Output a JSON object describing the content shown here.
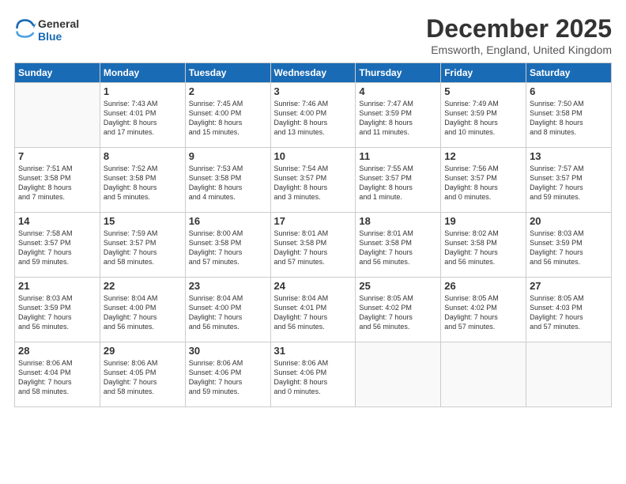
{
  "logo": {
    "line1": "General",
    "line2": "Blue"
  },
  "title": "December 2025",
  "location": "Emsworth, England, United Kingdom",
  "days_header": [
    "Sunday",
    "Monday",
    "Tuesday",
    "Wednesday",
    "Thursday",
    "Friday",
    "Saturday"
  ],
  "weeks": [
    [
      {
        "day": "",
        "info": ""
      },
      {
        "day": "1",
        "info": "Sunrise: 7:43 AM\nSunset: 4:01 PM\nDaylight: 8 hours\nand 17 minutes."
      },
      {
        "day": "2",
        "info": "Sunrise: 7:45 AM\nSunset: 4:00 PM\nDaylight: 8 hours\nand 15 minutes."
      },
      {
        "day": "3",
        "info": "Sunrise: 7:46 AM\nSunset: 4:00 PM\nDaylight: 8 hours\nand 13 minutes."
      },
      {
        "day": "4",
        "info": "Sunrise: 7:47 AM\nSunset: 3:59 PM\nDaylight: 8 hours\nand 11 minutes."
      },
      {
        "day": "5",
        "info": "Sunrise: 7:49 AM\nSunset: 3:59 PM\nDaylight: 8 hours\nand 10 minutes."
      },
      {
        "day": "6",
        "info": "Sunrise: 7:50 AM\nSunset: 3:58 PM\nDaylight: 8 hours\nand 8 minutes."
      }
    ],
    [
      {
        "day": "7",
        "info": "Sunrise: 7:51 AM\nSunset: 3:58 PM\nDaylight: 8 hours\nand 7 minutes."
      },
      {
        "day": "8",
        "info": "Sunrise: 7:52 AM\nSunset: 3:58 PM\nDaylight: 8 hours\nand 5 minutes."
      },
      {
        "day": "9",
        "info": "Sunrise: 7:53 AM\nSunset: 3:58 PM\nDaylight: 8 hours\nand 4 minutes."
      },
      {
        "day": "10",
        "info": "Sunrise: 7:54 AM\nSunset: 3:57 PM\nDaylight: 8 hours\nand 3 minutes."
      },
      {
        "day": "11",
        "info": "Sunrise: 7:55 AM\nSunset: 3:57 PM\nDaylight: 8 hours\nand 1 minute."
      },
      {
        "day": "12",
        "info": "Sunrise: 7:56 AM\nSunset: 3:57 PM\nDaylight: 8 hours\nand 0 minutes."
      },
      {
        "day": "13",
        "info": "Sunrise: 7:57 AM\nSunset: 3:57 PM\nDaylight: 7 hours\nand 59 minutes."
      }
    ],
    [
      {
        "day": "14",
        "info": "Sunrise: 7:58 AM\nSunset: 3:57 PM\nDaylight: 7 hours\nand 59 minutes."
      },
      {
        "day": "15",
        "info": "Sunrise: 7:59 AM\nSunset: 3:57 PM\nDaylight: 7 hours\nand 58 minutes."
      },
      {
        "day": "16",
        "info": "Sunrise: 8:00 AM\nSunset: 3:58 PM\nDaylight: 7 hours\nand 57 minutes."
      },
      {
        "day": "17",
        "info": "Sunrise: 8:01 AM\nSunset: 3:58 PM\nDaylight: 7 hours\nand 57 minutes."
      },
      {
        "day": "18",
        "info": "Sunrise: 8:01 AM\nSunset: 3:58 PM\nDaylight: 7 hours\nand 56 minutes."
      },
      {
        "day": "19",
        "info": "Sunrise: 8:02 AM\nSunset: 3:58 PM\nDaylight: 7 hours\nand 56 minutes."
      },
      {
        "day": "20",
        "info": "Sunrise: 8:03 AM\nSunset: 3:59 PM\nDaylight: 7 hours\nand 56 minutes."
      }
    ],
    [
      {
        "day": "21",
        "info": "Sunrise: 8:03 AM\nSunset: 3:59 PM\nDaylight: 7 hours\nand 56 minutes."
      },
      {
        "day": "22",
        "info": "Sunrise: 8:04 AM\nSunset: 4:00 PM\nDaylight: 7 hours\nand 56 minutes."
      },
      {
        "day": "23",
        "info": "Sunrise: 8:04 AM\nSunset: 4:00 PM\nDaylight: 7 hours\nand 56 minutes."
      },
      {
        "day": "24",
        "info": "Sunrise: 8:04 AM\nSunset: 4:01 PM\nDaylight: 7 hours\nand 56 minutes."
      },
      {
        "day": "25",
        "info": "Sunrise: 8:05 AM\nSunset: 4:02 PM\nDaylight: 7 hours\nand 56 minutes."
      },
      {
        "day": "26",
        "info": "Sunrise: 8:05 AM\nSunset: 4:02 PM\nDaylight: 7 hours\nand 57 minutes."
      },
      {
        "day": "27",
        "info": "Sunrise: 8:05 AM\nSunset: 4:03 PM\nDaylight: 7 hours\nand 57 minutes."
      }
    ],
    [
      {
        "day": "28",
        "info": "Sunrise: 8:06 AM\nSunset: 4:04 PM\nDaylight: 7 hours\nand 58 minutes."
      },
      {
        "day": "29",
        "info": "Sunrise: 8:06 AM\nSunset: 4:05 PM\nDaylight: 7 hours\nand 58 minutes."
      },
      {
        "day": "30",
        "info": "Sunrise: 8:06 AM\nSunset: 4:06 PM\nDaylight: 7 hours\nand 59 minutes."
      },
      {
        "day": "31",
        "info": "Sunrise: 8:06 AM\nSunset: 4:06 PM\nDaylight: 8 hours\nand 0 minutes."
      },
      {
        "day": "",
        "info": ""
      },
      {
        "day": "",
        "info": ""
      },
      {
        "day": "",
        "info": ""
      }
    ]
  ]
}
